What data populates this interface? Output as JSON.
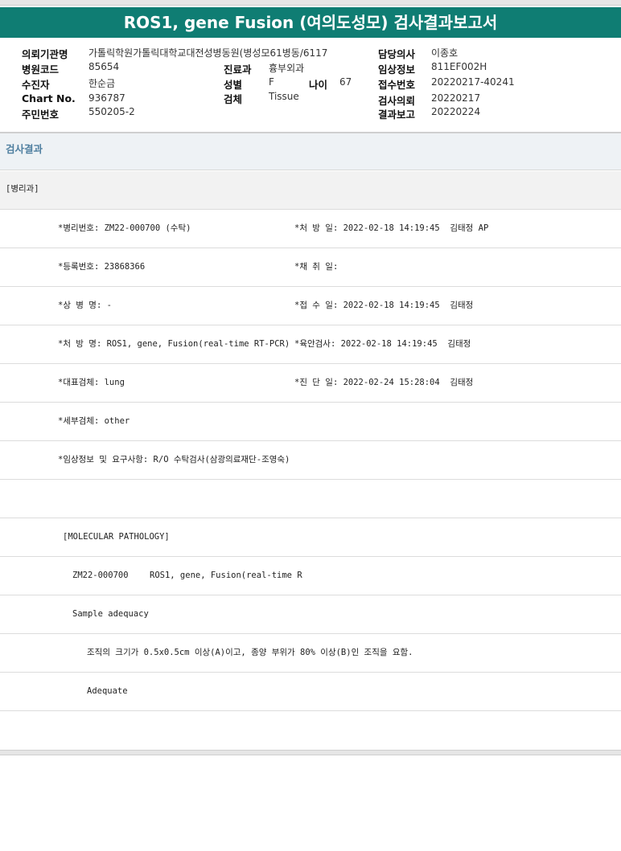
{
  "title": "ROS1, gene Fusion (여의도성모) 검사결과보고서",
  "header": {
    "institution_label": "의뢰기관명",
    "institution_value": "가톨릭학원가톨릭대학교대전성병동원(병성모61병동/6117",
    "doctor_label": "담당의사",
    "doctor_value": "이종호",
    "hospital_code_label": "병원코드",
    "hospital_code_value": "85654",
    "department_label": "진료과",
    "department_value": "흉부외과",
    "clinical_info_label": "임상정보",
    "clinical_info_value": "811EF002H",
    "patient_label": "수진자",
    "patient_value": "한순금",
    "sex_label": "성별",
    "sex_value": "F",
    "age_label": "나이",
    "age_value": "67",
    "receipt_no_label": "접수번호",
    "receipt_no_value": "20220217-40241",
    "chart_no_label": "Chart No.",
    "chart_no_value": "936787",
    "specimen_label": "검체",
    "specimen_value": "Tissue",
    "request_label": "검사의뢰",
    "request_value": "20220217",
    "resident_no_label": "주민번호",
    "resident_no_value": "550205-2",
    "report_label": "결과보고",
    "report_value": "20220224"
  },
  "section_title": "검사결과",
  "rows": {
    "r0": "[병리과]",
    "r1_left": "*병리번호: ZM22-000700 (수탁)",
    "r1_right": "*처 방 일: 2022-02-18 14:19:45  김태정 AP",
    "r2_left": "*등록번호: 23868366",
    "r2_right": "*채 취 일:",
    "r3_left": "*상 병 명: -",
    "r3_right": "*접 수 일: 2022-02-18 14:19:45  김태정",
    "r4_left": "*처 방 명: ROS1, gene, Fusion(real-time RT-PCR)",
    "r4_right": "*육안검사: 2022-02-18 14:19:45  김태정",
    "r5_left": "*대표검체: lung",
    "r5_right": "*진 단 일: 2022-02-24 15:28:04  김태정",
    "r6_left": "*세부검체: other",
    "r7_left": "*임상정보 및 요구사항: R/O 수탁검사(삼광의료재단-조영숙)",
    "r8": "",
    "r9": "[MOLECULAR PATHOLOGY]",
    "r10_a": "ZM22-000700",
    "r10_b": "ROS1, gene, Fusion(real-time R",
    "r11": "Sample adequacy",
    "r12": "조직의 크기가 0.5x0.5cm 이상(A)이고, 종양 부위가 80% 이상(B)인 조직을 요함.",
    "r13": "Adequate",
    "r14": ""
  }
}
